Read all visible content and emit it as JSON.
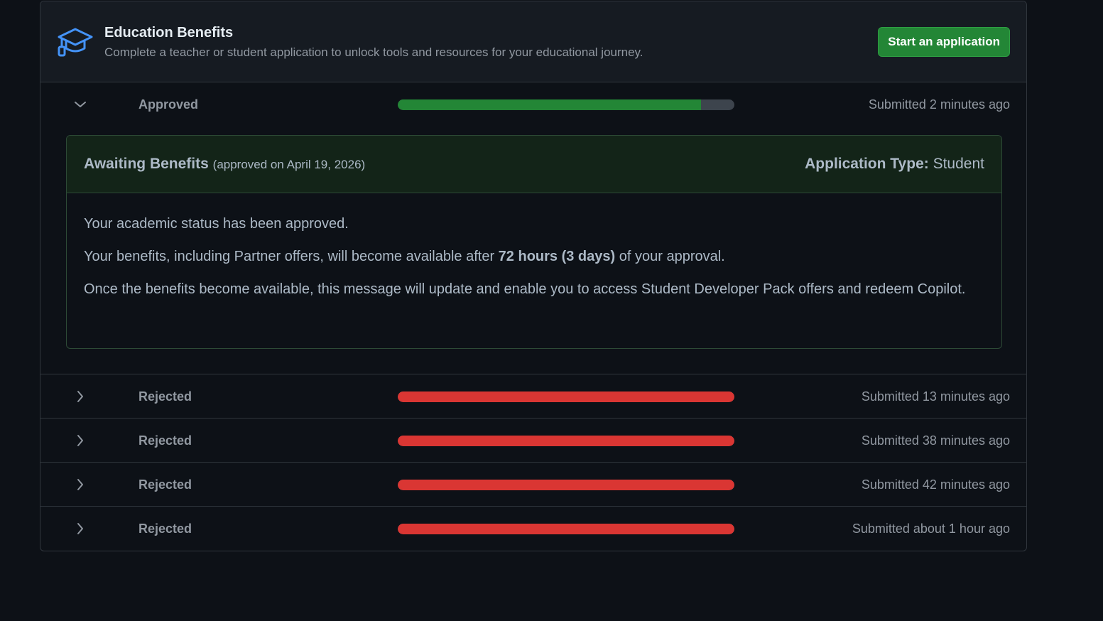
{
  "header": {
    "title": "Education Benefits",
    "subtitle": "Complete a teacher or student application to unlock tools and resources for your educational journey.",
    "start_button": "Start an application",
    "icon": "graduation-cap-icon"
  },
  "colors": {
    "approved": "#238636",
    "rejected": "#da3633",
    "track": "#3d444d",
    "accent": "#4493f8"
  },
  "applications": [
    {
      "status": "Approved",
      "submitted": "Submitted 2 minutes ago",
      "progress": 0.9,
      "expanded": true,
      "detail": {
        "title": "Awaiting Benefits",
        "approved_on": "(approved on April 19, 2026)",
        "type_label": "Application Type:",
        "type_value": "Student",
        "line1": "Your academic status has been approved.",
        "line2_pre": "Your benefits, including Partner offers, will become available after ",
        "line2_bold": "72 hours (3 days)",
        "line2_post": " of your approval.",
        "line3": "Once the benefits become available, this message will update and enable you to access Student Developer Pack offers and redeem Copilot."
      }
    },
    {
      "status": "Rejected",
      "submitted": "Submitted 13 minutes ago",
      "progress": 1.0,
      "expanded": false
    },
    {
      "status": "Rejected",
      "submitted": "Submitted 38 minutes ago",
      "progress": 1.0,
      "expanded": false
    },
    {
      "status": "Rejected",
      "submitted": "Submitted 42 minutes ago",
      "progress": 1.0,
      "expanded": false
    },
    {
      "status": "Rejected",
      "submitted": "Submitted about 1 hour ago",
      "progress": 1.0,
      "expanded": false
    }
  ]
}
